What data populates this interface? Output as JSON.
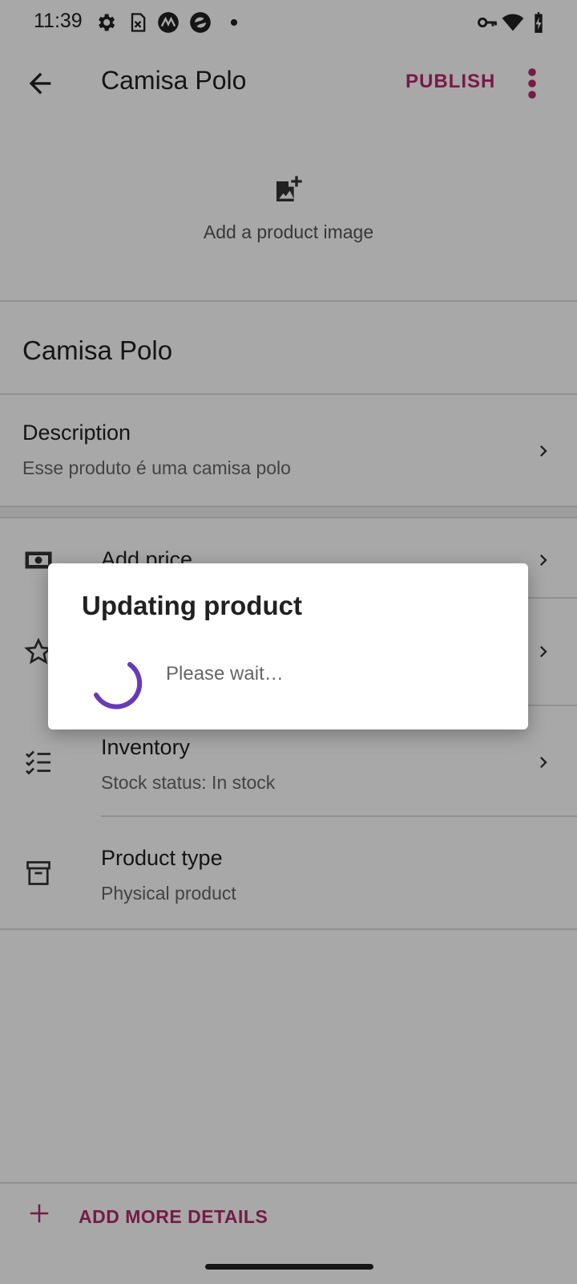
{
  "status_bar": {
    "time": "11:39"
  },
  "app_bar": {
    "title": "Camisa Polo",
    "publish_label": "PUBLISH"
  },
  "image_area": {
    "add_image_label": "Add a product image"
  },
  "product": {
    "name": "Camisa Polo",
    "description_label": "Description",
    "description_value": "Esse produto é uma camisa polo"
  },
  "rows": {
    "price_label": "Add price",
    "inventory_label": "Inventory",
    "inventory_value": "Stock status: In stock",
    "product_type_label": "Product type",
    "product_type_value": "Physical product"
  },
  "footer": {
    "add_more_label": "ADD MORE DETAILS"
  },
  "dialog": {
    "title": "Updating product",
    "message": "Please wait…"
  },
  "colors": {
    "accent": "#b5296b",
    "spinner": "#673ab7"
  }
}
